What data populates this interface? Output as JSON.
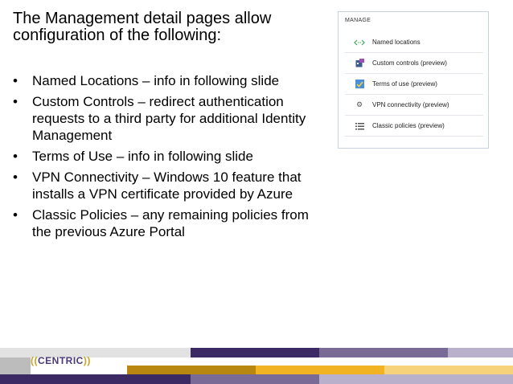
{
  "slide": {
    "heading": "The Management detail pages allow configuration of the following:",
    "bullets": [
      "Named Locations – info in following slide",
      "Custom Controls – redirect authentication requests to a third party for additional Identity Management",
      "Terms of Use – info in following slide",
      "VPN Connectivity – Windows 10 feature that installs a VPN certificate provided by Azure",
      "Classic Policies – any remaining policies from the previous Azure Portal"
    ]
  },
  "panel": {
    "title": "MANAGE",
    "items": [
      {
        "label": "Named locations",
        "icon": "arrows-icon"
      },
      {
        "label": "Custom controls (preview)",
        "icon": "custom-controls-icon"
      },
      {
        "label": "Terms of use (preview)",
        "icon": "terms-check-icon"
      },
      {
        "label": "VPN connectivity (preview)",
        "icon": "gear-icon"
      },
      {
        "label": "Classic policies (preview)",
        "icon": "list-icon"
      }
    ]
  },
  "footer": {
    "logo_left": "((",
    "logo_word": "CENTRIC",
    "logo_right": "))"
  },
  "colors": {
    "purple_dark": "#3b2a63",
    "purple_mid": "#7a6a96",
    "lavender": "#b9b0cc",
    "gold": "#d9a21a",
    "gold_light": "#f1c75a",
    "gray": "#bcbcbc"
  }
}
